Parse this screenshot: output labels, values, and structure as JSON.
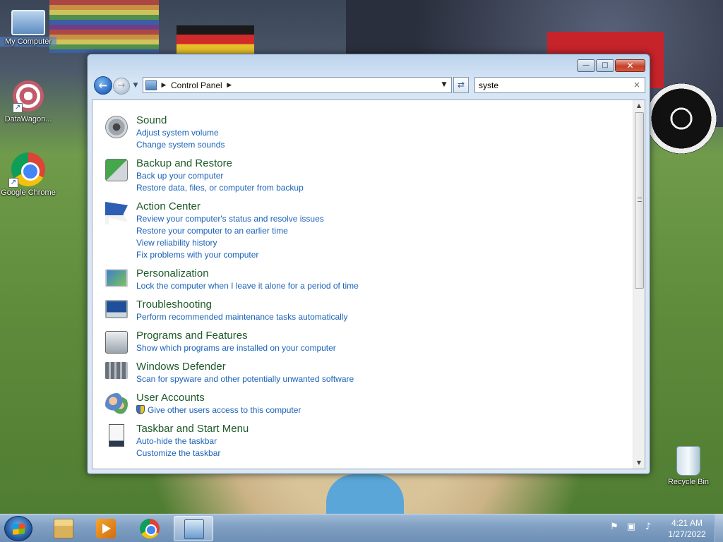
{
  "desktop": {
    "icons": [
      {
        "label": "My Computer"
      },
      {
        "label": "DataWagon..."
      },
      {
        "label": "Google Chrome"
      },
      {
        "label": "Recycle Bin"
      }
    ]
  },
  "window": {
    "address": {
      "segments": [
        "Control Panel"
      ]
    },
    "search": {
      "value": "syste",
      "clear_glyph": "×"
    },
    "controls": {
      "minimize": "—",
      "maximize": "□",
      "close": "✕"
    }
  },
  "results": [
    {
      "title": "Sound",
      "icon": "speaker-icon",
      "links": [
        "Adjust system volume",
        "Change system sounds"
      ]
    },
    {
      "title": "Backup and Restore",
      "icon": "backup-icon",
      "links": [
        "Back up your computer",
        "Restore data, files, or computer from backup"
      ]
    },
    {
      "title": "Action Center",
      "icon": "flag-icon",
      "links": [
        "Review your computer's status and resolve issues",
        "Restore your computer to an earlier time",
        "View reliability history",
        "Fix problems with your computer"
      ]
    },
    {
      "title": "Personalization",
      "icon": "monitor-icon",
      "links": [
        "Lock the computer when I leave it alone for a period of time"
      ]
    },
    {
      "title": "Troubleshooting",
      "icon": "troubleshoot-icon",
      "links": [
        "Perform recommended maintenance tasks automatically"
      ]
    },
    {
      "title": "Programs and Features",
      "icon": "programs-icon",
      "links": [
        "Show which programs are installed on your computer"
      ]
    },
    {
      "title": "Windows Defender",
      "icon": "defender-icon",
      "links": [
        "Scan for spyware and other potentially unwanted software"
      ]
    },
    {
      "title": "User Accounts",
      "icon": "users-icon",
      "links": [
        "Give other users access to this computer"
      ]
    },
    {
      "title": "Taskbar and Start Menu",
      "icon": "taskbar-icon",
      "links": [
        "Auto-hide the taskbar",
        "Customize the taskbar"
      ]
    }
  ],
  "taskbar": {
    "apps": [
      "Windows Explorer",
      "Windows Media Player",
      "Google Chrome",
      "Control Panel"
    ],
    "clock": {
      "time": "4:21 AM",
      "date": "1/27/2022"
    }
  }
}
